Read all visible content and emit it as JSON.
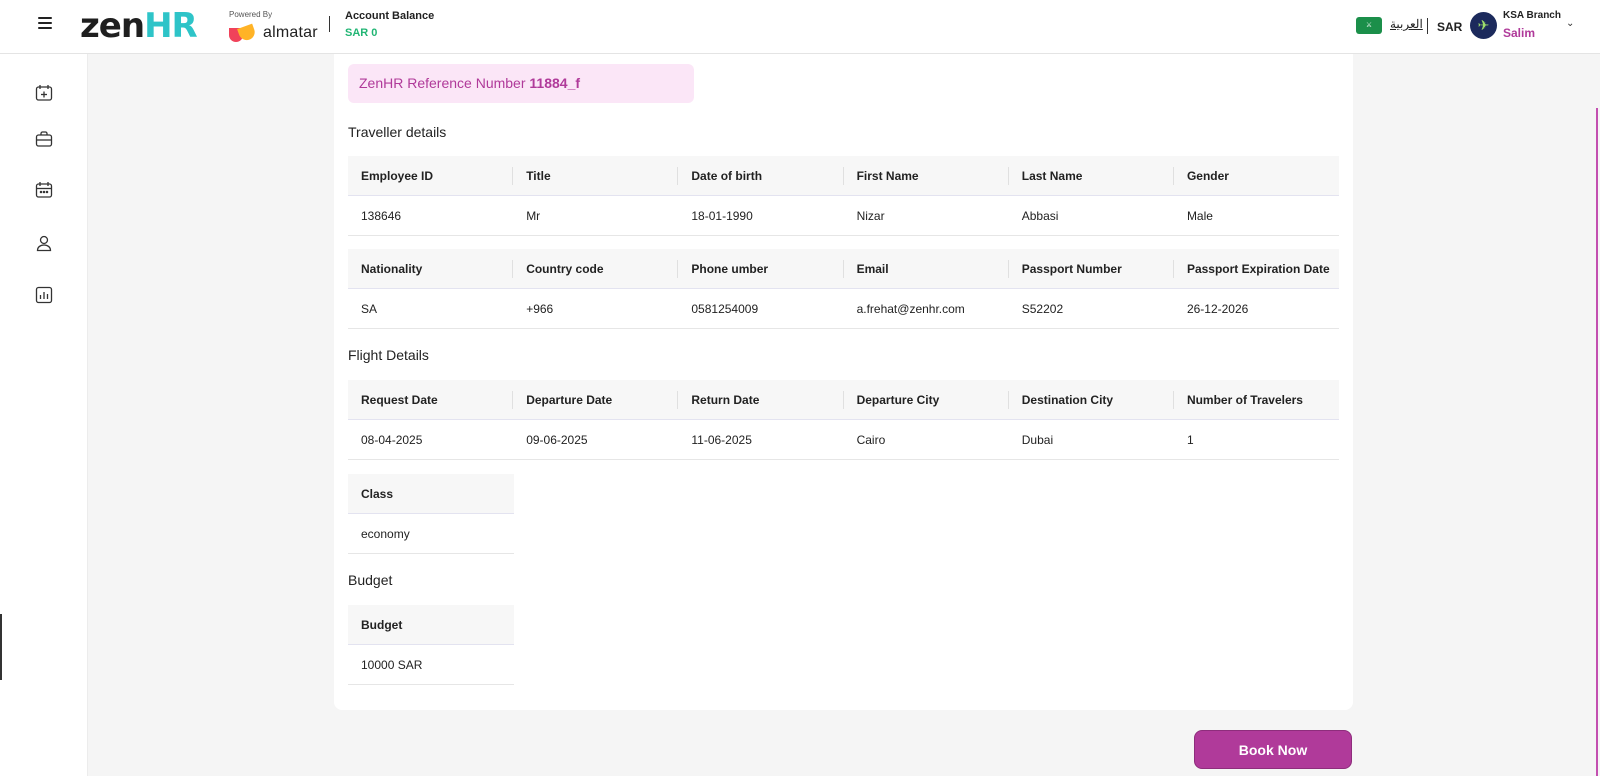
{
  "header": {
    "logo_part1": "zen",
    "logo_part2": "HR",
    "powered_by": "Powered By",
    "partner": "almatar",
    "balance_label": "Account Balance",
    "balance_value": "SAR 0",
    "language": "العربية",
    "currency": "SAR",
    "branch": "KSA Branch",
    "user": "Salim"
  },
  "reference": {
    "label": "ZenHR Reference Number",
    "value": "11884_f"
  },
  "traveller": {
    "title": "Traveller details",
    "table1": {
      "headers": [
        "Employee ID",
        "Title",
        "Date of birth",
        "First Name",
        "Last Name",
        "Gender"
      ],
      "values": [
        "138646",
        "Mr",
        "18-01-1990",
        "Nizar",
        "Abbasi",
        "Male"
      ]
    },
    "table2": {
      "headers": [
        "Nationality",
        "Country code",
        "Phone umber",
        "Email",
        "Passport Number",
        "Passport Expiration Date"
      ],
      "values": [
        "SA",
        "+966",
        "0581254009",
        "a.frehat@zenhr.com",
        "S52202",
        "26-12-2026"
      ]
    }
  },
  "flight": {
    "title": "Flight Details",
    "table1": {
      "headers": [
        "Request Date",
        "Departure Date",
        "Return Date",
        "Departure City",
        "Destination City",
        "Number of Travelers"
      ],
      "values": [
        "08-04-2025",
        "09-06-2025",
        "11-06-2025",
        "Cairo",
        "Dubai",
        "1"
      ]
    },
    "class_header": "Class",
    "class_value": "economy"
  },
  "budget": {
    "title": "Budget",
    "header": "Budget",
    "value": "10000 SAR"
  },
  "actions": {
    "book_label": "Book Now"
  },
  "colors": {
    "accent": "#b03a9a",
    "brand_teal": "#2ec4c8",
    "balance_green": "#21b574",
    "ref_bg": "#fbe6f7"
  }
}
